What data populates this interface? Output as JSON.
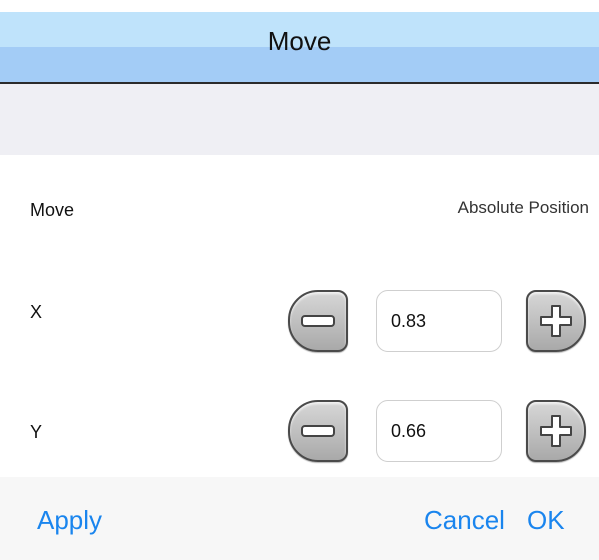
{
  "dialog": {
    "title": "Move"
  },
  "header": {
    "mode_left": "Move",
    "mode_right": "Absolute Position"
  },
  "rows": [
    {
      "label": "X",
      "value": "0.83"
    },
    {
      "label": "Y",
      "value": "0.66"
    }
  ],
  "icons": {
    "decrement": "minus-icon",
    "increment": "plus-icon"
  },
  "footer": {
    "apply": "Apply",
    "cancel": "Cancel",
    "ok": "OK"
  },
  "colors": {
    "accent": "#1a85ee",
    "titlebar_top": "#bfe3fb",
    "titlebar_bottom": "#a3ccf6"
  }
}
